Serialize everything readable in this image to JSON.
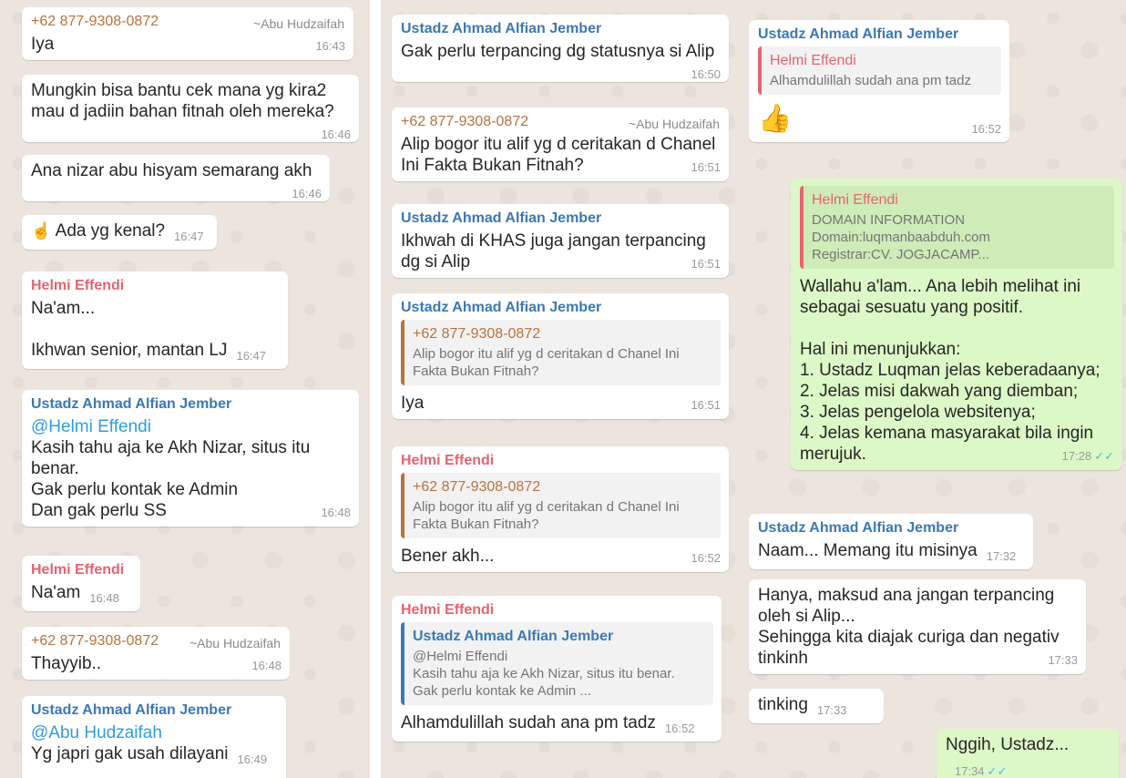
{
  "columns": [
    {
      "messages": [
        {
          "sender": "+62 877-9308-0872",
          "alias": "~Abu Hudzaifah",
          "text": "Iya",
          "time": "16:43"
        },
        {
          "text": "Mungkin bisa bantu cek mana yg kira2 mau d jadiin bahan fitnah oleh mereka?",
          "time": "16:46"
        },
        {
          "text": "Ana nizar abu hisyam semarang akh",
          "time": "16:46"
        },
        {
          "emoji": "☝",
          "text": "Ada yg kenal?",
          "time": "16:47"
        },
        {
          "sender": "Helmi Effendi",
          "text": "Na'am...\n\nIkhwan senior, mantan LJ",
          "time": "16:47"
        },
        {
          "sender": "Ustadz Ahmad Alfian Jember",
          "mention": "@Helmi Effendi",
          "text": "Kasih tahu aja ke Akh Nizar,  situs itu benar.\nGak perlu kontak ke Admin\nDan gak perlu SS",
          "time": "16:48"
        },
        {
          "sender": "Helmi Effendi",
          "text": "Na'am",
          "time": "16:48"
        },
        {
          "sender": "+62 877-9308-0872",
          "alias": "~Abu Hudzaifah",
          "text": "Thayyib..",
          "time": "16:48"
        },
        {
          "sender": "Ustadz Ahmad Alfian Jember",
          "mention": "@Abu Hudzaifah",
          "text": "Yg japri gak usah dilayani",
          "time": "16:49"
        }
      ]
    },
    {
      "messages": [
        {
          "sender": "Ustadz Ahmad Alfian Jember",
          "text": "Gak perlu terpancing dg statusnya si Alip",
          "time": "16:50"
        },
        {
          "sender": "+62 877-9308-0872",
          "alias": "~Abu Hudzaifah",
          "text": "Alip bogor itu alif yg d ceritakan d Chanel Ini Fakta Bukan Fitnah?",
          "time": "16:51"
        },
        {
          "sender": "Ustadz Ahmad Alfian Jember",
          "text": "Ikhwah di KHAS juga jangan terpancing dg si Alip",
          "time": "16:51"
        },
        {
          "sender": "Ustadz Ahmad Alfian Jember",
          "quote_name": "+62 877-9308-0872",
          "quote_text": "Alip bogor itu alif yg d ceritakan d Chanel Ini Fakta Bukan Fitnah?",
          "text": "Iya",
          "time": "16:51"
        },
        {
          "sender": "Helmi Effendi",
          "quote_name": "+62 877-9308-0872",
          "quote_text": "Alip bogor itu alif yg d ceritakan d Chanel Ini Fakta Bukan Fitnah?",
          "text": "Bener akh...",
          "time": "16:52"
        },
        {
          "sender": "Helmi Effendi",
          "quote_name": "Ustadz Ahmad Alfian Jember",
          "quote_text": "@Helmi Effendi\nKasih tahu aja ke Akh Nizar,  situs itu benar.\nGak perlu kontak ke Admin ...",
          "text": "Alhamdulillah sudah ana pm tadz",
          "time": "16:52"
        }
      ]
    },
    {
      "messages": [
        {
          "sender": "Ustadz Ahmad Alfian Jember",
          "quote_name": "Helmi Effendi",
          "quote_text": "Alhamdulillah sudah ana pm tadz",
          "emoji": "👍",
          "time": "16:52"
        },
        {
          "quote_name": "Helmi Effendi",
          "quote_text": "DOMAIN INFORMATION\nDomain:luqmanbaabduh.com\nRegistrar:CV. JOGJACAMP...",
          "text": "Wallahu a'lam... Ana lebih melihat ini sebagai sesuatu yang positif.\n\nHal ini menunjukkan:\n1. Ustadz Luqman jelas keberadaanya;\n2. Jelas misi dakwah yang diemban;\n3. Jelas pengelola websitenya;\n4. Jelas kemana masyarakat bila ingin merujuk.",
          "time": "17:28",
          "ticks": "✓✓"
        },
        {
          "sender": "Ustadz Ahmad Alfian Jember",
          "text": "Naam... Memang itu misinya",
          "time": "17:32"
        },
        {
          "text": "Hanya, maksud ana jangan terpancing oleh si Alip...\nSehingga kita diajak curiga dan negativ tinkinh",
          "time": "17:33"
        },
        {
          "text": "tinking",
          "time": "17:33"
        },
        {
          "text": "Nggih, Ustadz...",
          "time": "17:34",
          "ticks": "✓✓"
        }
      ]
    }
  ]
}
